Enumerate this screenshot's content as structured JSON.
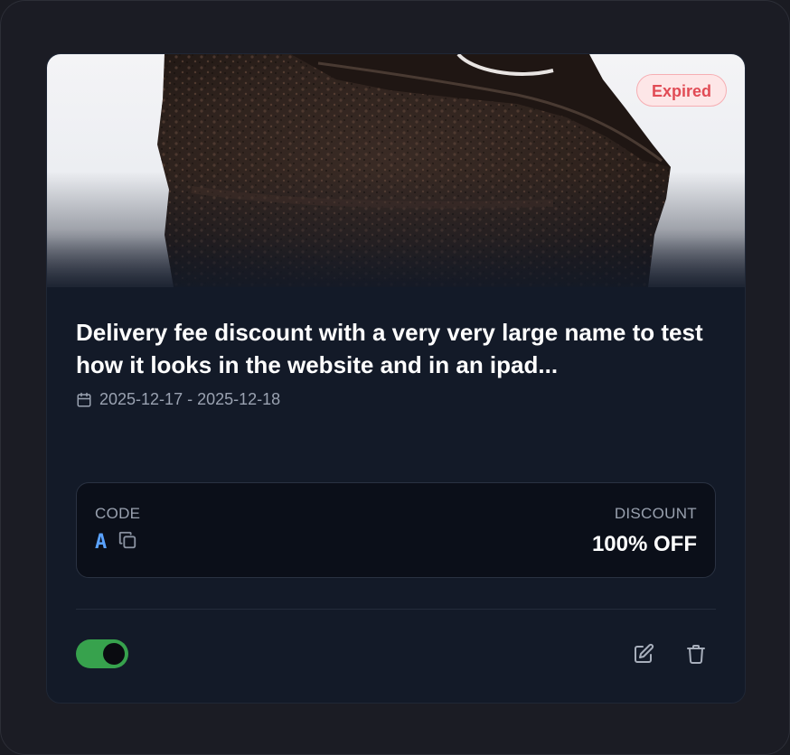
{
  "coupon": {
    "status_badge": "Expired",
    "title": "Delivery fee discount with a very very large name to test how it looks in the website and in an ipad...",
    "date_range": "2025-12-17 - 2025-12-18",
    "code_label": "CODE",
    "code": "A",
    "discount_label": "DISCOUNT",
    "discount": "100% OFF",
    "active": true,
    "image_subject": "chocolate cake slice"
  },
  "icons": {
    "calendar": "calendar-icon",
    "copy": "copy-icon",
    "edit": "edit-icon",
    "delete": "trash-icon"
  },
  "colors": {
    "expired_badge_text": "#e14b55",
    "expired_badge_bg": "#fde6e7",
    "code_accent": "#5aa2ff",
    "toggle_on": "#37a24d"
  }
}
